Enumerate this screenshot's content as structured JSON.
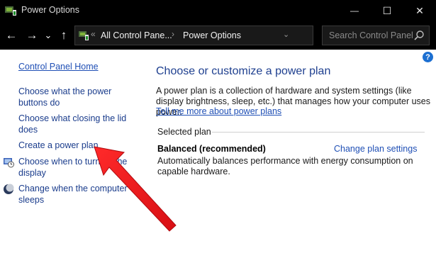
{
  "window": {
    "title": "Power Options",
    "minimize_glyph": "—",
    "maximize_glyph": "☐",
    "close_glyph": "✕"
  },
  "toolbar": {
    "back_glyph": "←",
    "forward_glyph": "→",
    "recent_glyph": "⌄",
    "up_glyph": "↑",
    "refresh_glyph": "↻"
  },
  "address": {
    "overflow_glyph": "«",
    "separator_glyph": "›",
    "crumbs": [
      "All Control Pane...",
      "Power Options"
    ]
  },
  "search": {
    "placeholder": "Search Control Panel"
  },
  "help": {
    "glyph": "?"
  },
  "sidebar": {
    "home": "Control Panel Home",
    "items": [
      {
        "label": "Choose what the power buttons do"
      },
      {
        "label": "Choose what closing the lid does"
      },
      {
        "label": "Create a power plan"
      },
      {
        "label": "Choose when to turn off the display",
        "icon": "display-clock-icon"
      },
      {
        "label": "Change when the computer sleeps",
        "icon": "moon-icon"
      }
    ]
  },
  "main": {
    "title": "Choose or customize a power plan",
    "description": "A power plan is a collection of hardware and system settings (like display brightness, sleep, etc.) that manages how your computer uses power.",
    "more_link": "Tell me more about power plans",
    "selected_plan_label": "Selected plan",
    "plan": {
      "name": "Balanced (recommended)",
      "change_link": "Change plan settings",
      "description": "Automatically balances performance with energy consumption on capable hardware."
    }
  },
  "colors": {
    "titlebar": "#000000",
    "link": "#1a3c8c",
    "heading": "#1e3f8f",
    "annotation_arrow": "#e8141a"
  }
}
